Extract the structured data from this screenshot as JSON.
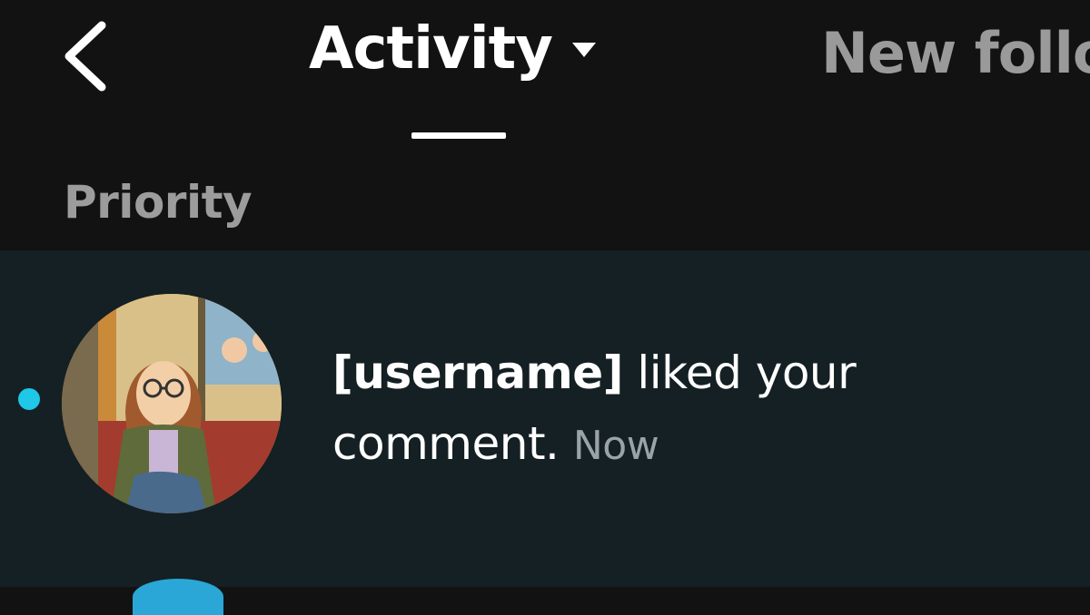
{
  "header": {
    "active_tab": "Activity",
    "inactive_tab": "New follo",
    "section_label": "Priority"
  },
  "notification": {
    "username": "[username]",
    "action": " liked your comment.",
    "time": "Now",
    "unread": true
  },
  "icons": {
    "back": "chevron-left-icon",
    "dropdown": "caret-down-icon"
  },
  "colors": {
    "background": "#121212",
    "notification_bg": "#142023",
    "unread_dot": "#1ec8e6",
    "muted_text": "#9c9c9c"
  }
}
